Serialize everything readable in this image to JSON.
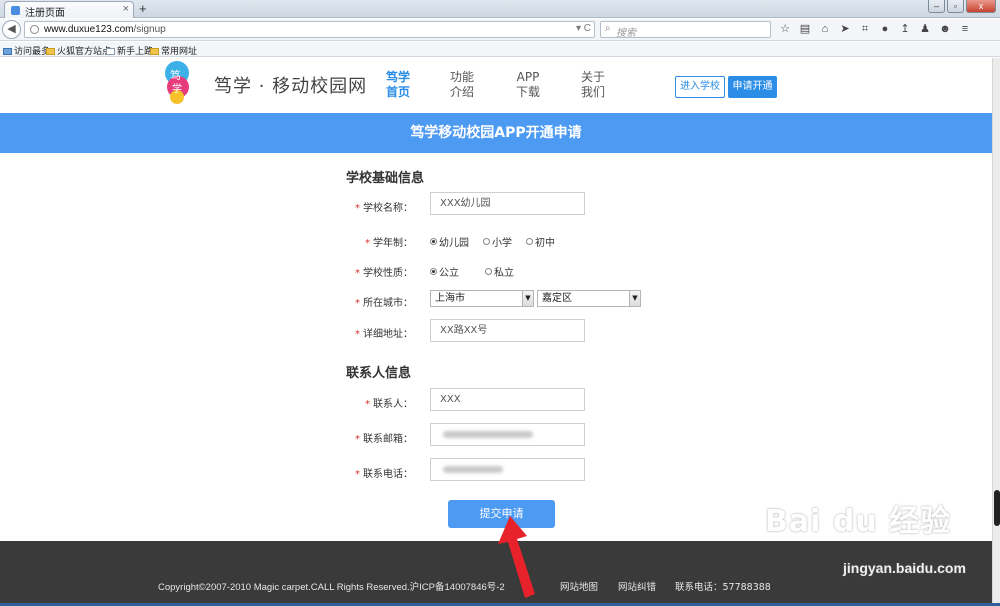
{
  "browser": {
    "tab_title": "注册页面",
    "tab_close": "×",
    "new_tab": "+",
    "window_controls": [
      "–",
      "▫",
      "x"
    ],
    "url_host": "www.duxue123.com",
    "url_path": "/signup",
    "url_controls": "▾ C",
    "search_placeholder": "搜索",
    "toolbar_icons": [
      "star-icon",
      "clipboard-icon",
      "home-icon",
      "send-icon",
      "crop-icon",
      "chat-icon",
      "share-icon",
      "person-icon",
      "smiley-icon"
    ],
    "bookmarks": [
      "访问最多",
      "火狐官方站点",
      "新手上路",
      "常用网址"
    ]
  },
  "header": {
    "logo_text": "笃学 · 移动校园网",
    "nav": [
      {
        "line1": "笃学",
        "line2": "首页",
        "active": true
      },
      {
        "line1": "功能",
        "line2": "介绍",
        "active": false
      },
      {
        "line1": "APP",
        "line2": "下载",
        "active": false
      },
      {
        "line1": "关于",
        "line2": "我们",
        "active": false
      }
    ],
    "login_label": "进入学校",
    "apply_label": "申请开通"
  },
  "banner": {
    "title": "笃学移动校园APP开通申请"
  },
  "form": {
    "required_mark": "*",
    "school_section": "学校基础信息",
    "school_name_label": "学校名称：",
    "school_name_value": "XXX幼儿园",
    "school_system_label": "学年制：",
    "school_system_options": [
      "幼儿园",
      "小学",
      "初中"
    ],
    "school_system_selected": "幼儿园",
    "school_type_label": "学校性质：",
    "school_type_options": [
      "公立",
      "私立"
    ],
    "school_type_selected": "公立",
    "city_label": "所在城市：",
    "city_value": "上海市",
    "district_value": "嘉定区",
    "address_label": "详细地址：",
    "address_value": "XX路XX号",
    "contact_section": "联系人信息",
    "contact_label": "联系人：",
    "contact_value": "XXX",
    "email_label": "联系邮箱：",
    "phone_label": "联系电话：",
    "submit_label": "提交申请"
  },
  "footer": {
    "copyright": "Copyright©2007-2010 Magic carpet.CALL Rights Reserved.沪ICP备14007846号-2",
    "sitemap": "网站地图",
    "report": "网站纠错",
    "phone": "联系电话：57788388"
  },
  "watermark": {
    "brand": "Bai du 经验",
    "url": "jingyan.baidu.com"
  },
  "colors": {
    "accent": "#4d9af3",
    "nav_active": "#2b8de6",
    "required": "#d9312b",
    "footer_bg": "#3a3a3a",
    "annotation": "#e8222a"
  }
}
